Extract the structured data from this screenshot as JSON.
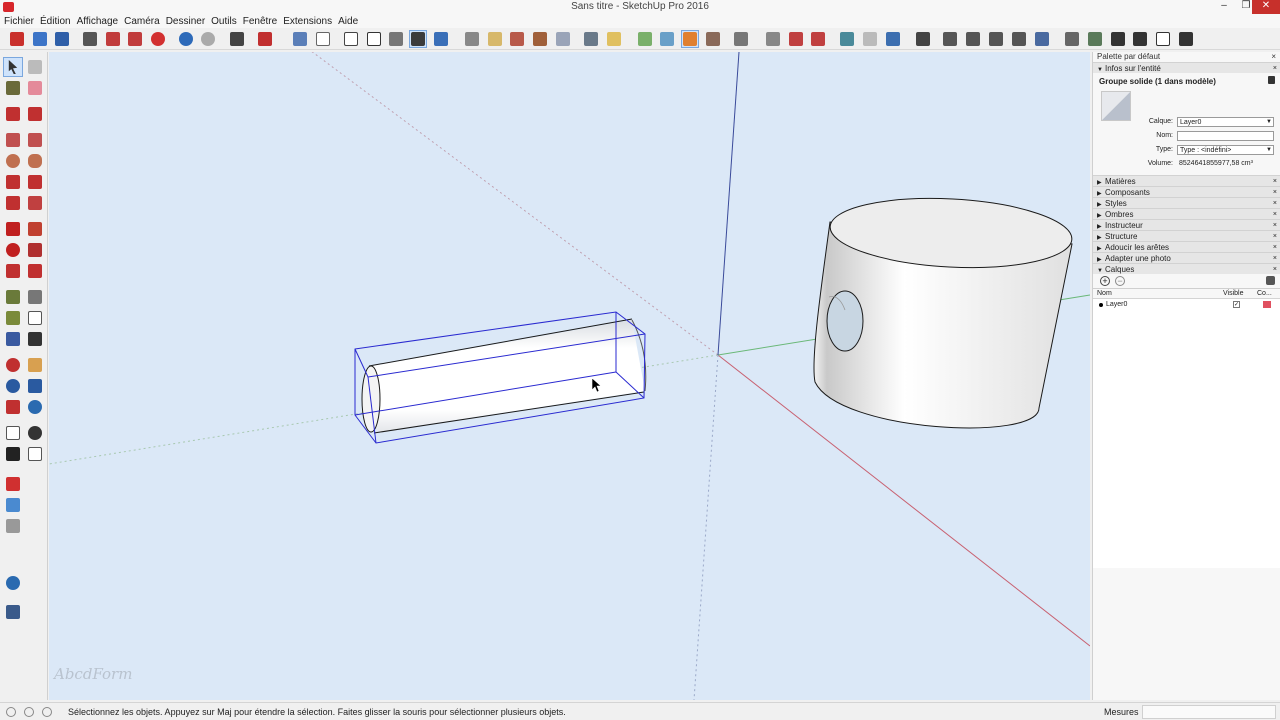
{
  "window": {
    "title": "Sans titre - SketchUp Pro 2016",
    "controls": {
      "minimize": "–",
      "maximize": "❐",
      "close": "✕"
    }
  },
  "menu": [
    "Fichier",
    "Édition",
    "Affichage",
    "Caméra",
    "Dessiner",
    "Outils",
    "Fenêtre",
    "Extensions",
    "Aide"
  ],
  "viewport": {
    "background": "#dbe8f7",
    "watermark": "AbcdForm",
    "axes": {
      "red": "#c0606a",
      "green": "#5cb06a",
      "blue": "#3a4a9a"
    },
    "selection_color": "#2a2ad0"
  },
  "panel": {
    "title": "Palette par défaut",
    "close": "×",
    "entity_info": {
      "header": "Infos sur l'entité",
      "title": "Groupe solide (1 dans modèle)",
      "fields": {
        "layer_label": "Calque:",
        "layer_value": "Layer0",
        "name_label": "Nom:",
        "name_value": "",
        "type_label": "Type:",
        "type_value": "Type : <indéfini>",
        "volume_label": "Volume:",
        "volume_value": "8524641855977,58 cm³"
      }
    },
    "sections": [
      "Matières",
      "Composants",
      "Styles",
      "Ombres",
      "Instructeur",
      "Structure",
      "Adoucir les arêtes",
      "Adapter une photo"
    ],
    "layers": {
      "header": "Calques",
      "columns": {
        "name": "Nom",
        "visible": "Visible",
        "color": "Co..."
      },
      "rows": [
        {
          "name": "Layer0",
          "visible": "✓",
          "color": "#e05060"
        }
      ]
    }
  },
  "status": {
    "message": "Sélectionnez les objets. Appuyez sur Maj pour étendre la sélection. Faites glisser la souris pour sélectionner plusieurs objets.",
    "measure_label": "Mesures",
    "measure_value": ""
  }
}
